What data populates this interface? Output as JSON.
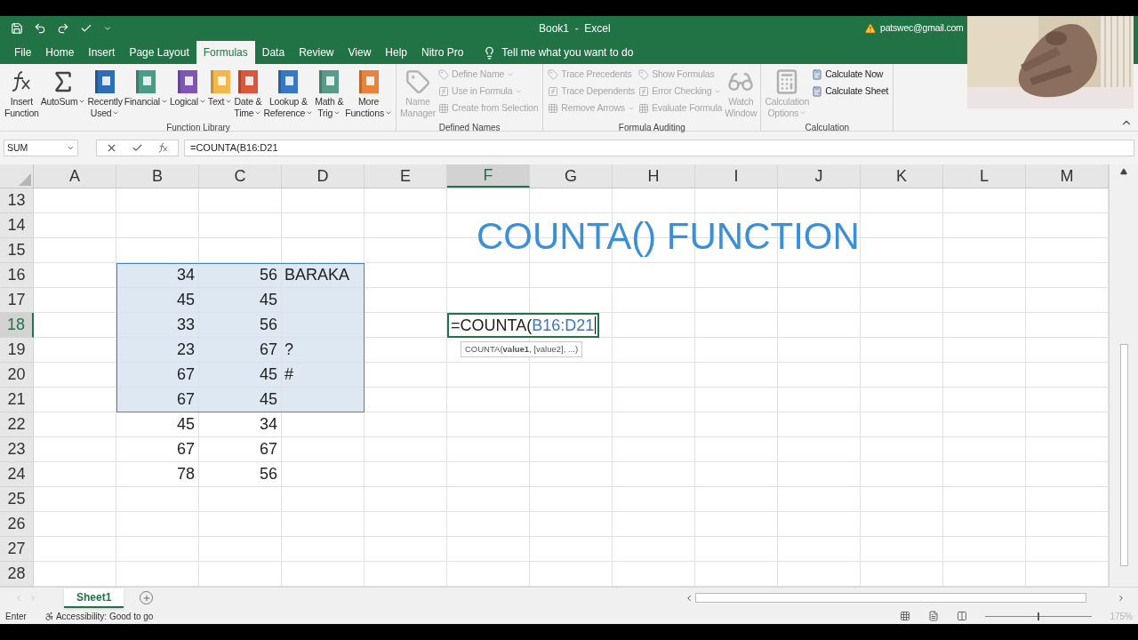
{
  "title_bar": {
    "title": "Book1  -  Excel",
    "account": "patswec@gmail.com"
  },
  "tabs": [
    {
      "label": "File",
      "selected": false
    },
    {
      "label": "Home",
      "selected": false
    },
    {
      "label": "Insert",
      "selected": false
    },
    {
      "label": "Page Layout",
      "selected": false
    },
    {
      "label": "Formulas",
      "selected": true
    },
    {
      "label": "Data",
      "selected": false
    },
    {
      "label": "Review",
      "selected": false
    },
    {
      "label": "View",
      "selected": false
    },
    {
      "label": "Help",
      "selected": false
    },
    {
      "label": "Nitro Pro",
      "selected": false
    }
  ],
  "tell_me": "Tell me what you want to do",
  "ribbon": [
    {
      "label": "Function Library",
      "buttons": [
        {
          "kind": "fx",
          "lines": [
            "Insert",
            "Function"
          ],
          "dropdown": false,
          "disabled": false
        },
        {
          "kind": "sum",
          "lines": [
            "AutoSum"
          ],
          "dropdown": true,
          "disabled": false
        },
        {
          "kind": "book",
          "color": "#2f6db5",
          "lines": [
            "Recently",
            "Used"
          ],
          "dropdown": true,
          "disabled": false
        },
        {
          "kind": "book",
          "color": "#4d9b86",
          "lines": [
            "Financial"
          ],
          "dropdown": true,
          "disabled": false
        },
        {
          "kind": "book",
          "color": "#7e57b5",
          "lines": [
            "Logical"
          ],
          "dropdown": true,
          "disabled": false
        },
        {
          "kind": "book",
          "color": "#f2b84b",
          "lines": [
            "Text"
          ],
          "dropdown": true,
          "disabled": false
        },
        {
          "kind": "book",
          "color": "#d9583b",
          "lines": [
            "Date &",
            "Time"
          ],
          "dropdown": true,
          "disabled": false
        },
        {
          "kind": "book",
          "color": "#3a77c2",
          "lines": [
            "Lookup &",
            "Reference"
          ],
          "dropdown": true,
          "disabled": false
        },
        {
          "kind": "book",
          "color": "#5b9a86",
          "lines": [
            "Math &",
            "Trig"
          ],
          "dropdown": true,
          "disabled": false
        },
        {
          "kind": "book",
          "color": "#e9823a",
          "lines": [
            "More",
            "Functions"
          ],
          "dropdown": true,
          "disabled": false
        }
      ]
    },
    {
      "label": "Defined Names",
      "buttons": [
        {
          "kind": "manager",
          "lines": [
            "Name",
            "Manager"
          ],
          "dropdown": false,
          "disabled": true
        },
        {
          "kind": "small",
          "items": [
            {
              "label": "Define Name",
              "dropdown": true,
              "disabled": true
            },
            {
              "label": "Use in Formula",
              "dropdown": true,
              "disabled": true
            },
            {
              "label": "Create from Selection",
              "dropdown": false,
              "disabled": true
            }
          ]
        }
      ]
    },
    {
      "label": "Formula Auditing",
      "buttons": [
        {
          "kind": "small",
          "items": [
            {
              "label": "Trace Precedents",
              "dropdown": false,
              "disabled": true
            },
            {
              "label": "Trace Dependents",
              "dropdown": false,
              "disabled": true
            },
            {
              "label": "Remove Arrows",
              "dropdown": true,
              "disabled": true
            }
          ]
        },
        {
          "kind": "small",
          "items": [
            {
              "label": "Show Formulas",
              "dropdown": false,
              "disabled": true
            },
            {
              "label": "Error Checking",
              "dropdown": true,
              "disabled": true
            },
            {
              "label": "Evaluate Formula",
              "dropdown": false,
              "disabled": true
            }
          ]
        },
        {
          "kind": "watch",
          "lines": [
            "Watch",
            "Window"
          ],
          "dropdown": false,
          "disabled": true
        }
      ]
    },
    {
      "label": "Calculation",
      "buttons": [
        {
          "kind": "calc",
          "lines": [
            "Calculation",
            "Options"
          ],
          "dropdown": true,
          "disabled": true
        },
        {
          "kind": "small",
          "items": [
            {
              "label": "Calculate Now",
              "dropdown": false,
              "disabled": false
            },
            {
              "label": "Calculate Sheet",
              "dropdown": false,
              "disabled": false
            }
          ]
        }
      ]
    }
  ],
  "name_box": "SUM",
  "formula": "=COUNTA(B16:D21",
  "columns": [
    {
      "label": "A",
      "selected": false
    },
    {
      "label": "B",
      "selected": false
    },
    {
      "label": "C",
      "selected": false
    },
    {
      "label": "D",
      "selected": false
    },
    {
      "label": "E",
      "selected": false
    },
    {
      "label": "F",
      "selected": true
    },
    {
      "label": "G",
      "selected": false
    },
    {
      "label": "H",
      "selected": false
    },
    {
      "label": "I",
      "selected": false
    },
    {
      "label": "J",
      "selected": false
    },
    {
      "label": "K",
      "selected": false
    },
    {
      "label": "L",
      "selected": false
    },
    {
      "label": "M",
      "selected": false
    }
  ],
  "rows": [
    {
      "label": "13",
      "selected": false
    },
    {
      "label": "14",
      "selected": false
    },
    {
      "label": "15",
      "selected": false
    },
    {
      "label": "16",
      "selected": false,
      "cells": [
        {
          "kind": "empty",
          "in_range": false
        },
        {
          "kind": "number",
          "text": "34",
          "in_range": true
        },
        {
          "kind": "number",
          "text": "56",
          "in_range": true
        },
        {
          "kind": "text",
          "text": "BARAKA",
          "in_range": true
        }
      ]
    },
    {
      "label": "17",
      "selected": false,
      "cells": [
        {
          "kind": "empty",
          "in_range": false
        },
        {
          "kind": "number",
          "text": "45",
          "in_range": true
        },
        {
          "kind": "number",
          "text": "45",
          "in_range": true
        },
        {
          "kind": "empty",
          "in_range": true
        }
      ]
    },
    {
      "label": "18",
      "selected": true,
      "cells": [
        {
          "kind": "empty",
          "in_range": false
        },
        {
          "kind": "number",
          "text": "33",
          "in_range": true
        },
        {
          "kind": "number",
          "text": "56",
          "in_range": true
        },
        {
          "kind": "empty",
          "in_range": true
        }
      ]
    },
    {
      "label": "19",
      "selected": false,
      "cells": [
        {
          "kind": "empty",
          "in_range": false
        },
        {
          "kind": "number",
          "text": "23",
          "in_range": true
        },
        {
          "kind": "number",
          "text": "67",
          "in_range": true
        },
        {
          "kind": "text",
          "text": "?",
          "in_range": true
        }
      ]
    },
    {
      "label": "20",
      "selected": false,
      "cells": [
        {
          "kind": "empty",
          "in_range": false
        },
        {
          "kind": "number",
          "text": "67",
          "in_range": true
        },
        {
          "kind": "number",
          "text": "45",
          "in_range": true
        },
        {
          "kind": "text",
          "text": "#",
          "in_range": true
        }
      ]
    },
    {
      "label": "21",
      "selected": false,
      "cells": [
        {
          "kind": "empty",
          "in_range": false
        },
        {
          "kind": "number",
          "text": "67",
          "in_range": true
        },
        {
          "kind": "number",
          "text": "45",
          "in_range": true
        },
        {
          "kind": "empty",
          "in_range": true
        }
      ]
    },
    {
      "label": "22",
      "selected": false,
      "cells": [
        {
          "kind": "empty",
          "in_range": false
        },
        {
          "kind": "number",
          "text": "45",
          "in_range": false
        },
        {
          "kind": "number",
          "text": "34",
          "in_range": false
        }
      ]
    },
    {
      "label": "23",
      "selected": false,
      "cells": [
        {
          "kind": "empty",
          "in_range": false
        },
        {
          "kind": "number",
          "text": "67",
          "in_range": false
        },
        {
          "kind": "number",
          "text": "67",
          "in_range": false
        }
      ]
    },
    {
      "label": "24",
      "selected": false,
      "cells": [
        {
          "kind": "empty",
          "in_range": false
        },
        {
          "kind": "number",
          "text": "78",
          "in_range": false
        },
        {
          "kind": "number",
          "text": "56",
          "in_range": false
        }
      ]
    },
    {
      "label": "25",
      "selected": false
    },
    {
      "label": "26",
      "selected": false
    },
    {
      "label": "27",
      "selected": false
    },
    {
      "label": "28",
      "selected": false
    }
  ],
  "heading": "COUNTA() FUNCTION",
  "active_cell": {
    "prefix": "=COUNTA(",
    "ref": "B16:D21"
  },
  "tooltip": "COUNTA(**value1**, [value2], ...)",
  "sheets": [
    {
      "label": "Sheet1",
      "selected": true
    }
  ],
  "status": {
    "mode": "Enter",
    "accessibility": "Accessibility: Good to go",
    "zoom": "175%",
    "zoom_slider": {
      "level": 0.5
    }
  }
}
